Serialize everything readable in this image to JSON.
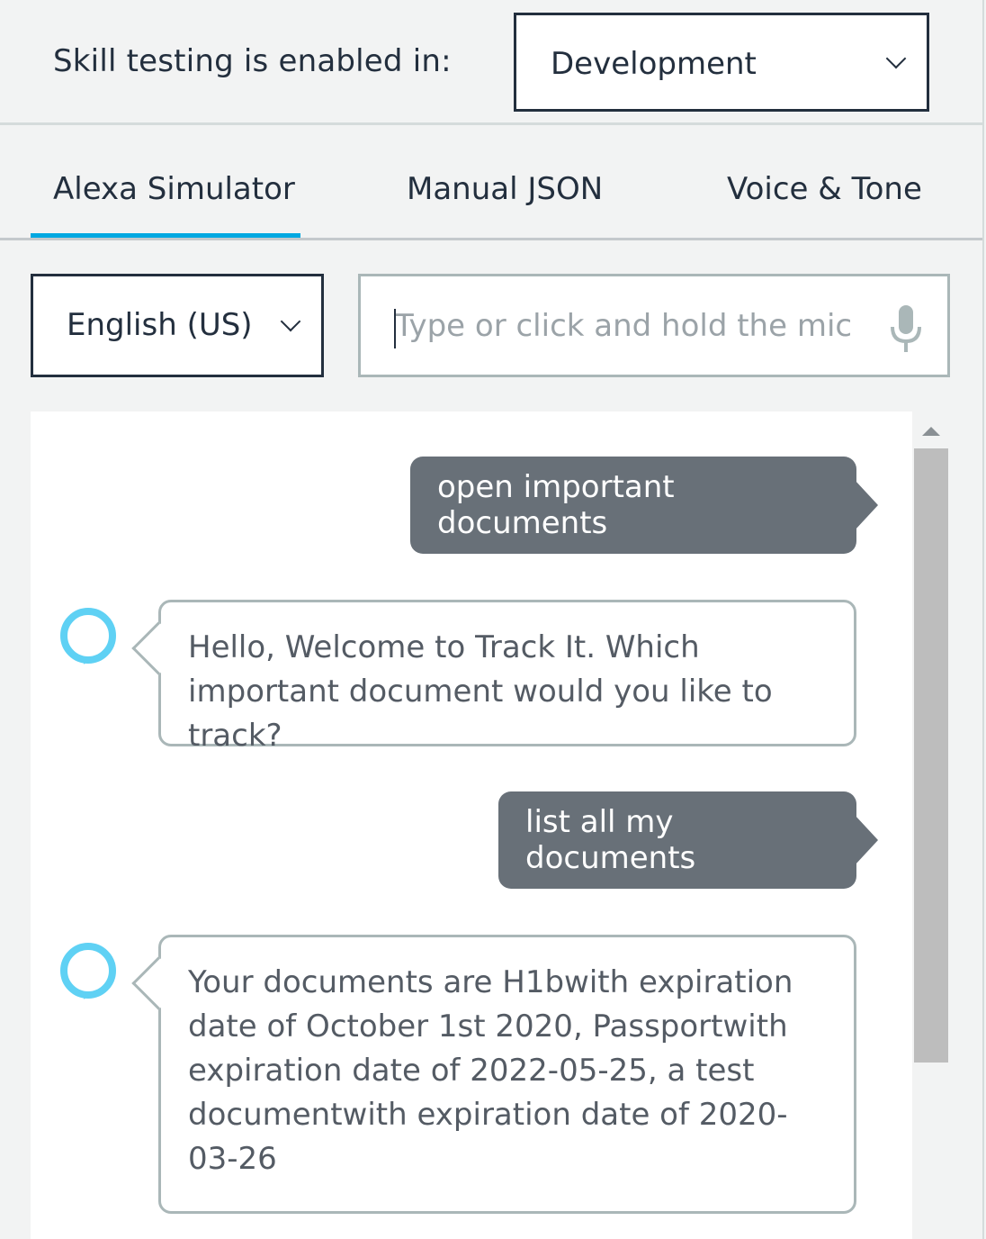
{
  "testing": {
    "label": "Skill testing is enabled in:",
    "stage_selected": "Development"
  },
  "tabs": [
    {
      "label": "Alexa Simulator",
      "active": true
    },
    {
      "label": "Manual JSON",
      "active": false
    },
    {
      "label": "Voice & Tone",
      "active": false
    }
  ],
  "locale": {
    "selected": "English (US)"
  },
  "utterance": {
    "placeholder": "Type or click and hold the mic",
    "value": ""
  },
  "conversation": [
    {
      "speaker": "user",
      "text": "open important documents"
    },
    {
      "speaker": "alexa",
      "text": "Hello, Welcome to Track It. Which important document would you like to track?"
    },
    {
      "speaker": "user",
      "text": "list all my documents"
    },
    {
      "speaker": "alexa",
      "text": "Your documents are H1bwith expiration date of October 1st 2020, Passportwith expiration date of 2022-05-25, a test documentwith expiration date of 2020-03-26"
    }
  ],
  "icons": {
    "stage_dropdown": "chevron-down-icon",
    "locale_dropdown": "chevron-down-icon",
    "mic": "microphone-icon",
    "alexa": "alexa-ring-icon",
    "scroll_up": "scroll-up-arrow-icon"
  },
  "colors": {
    "accent": "#00a8e1",
    "user_bubble": "#687078",
    "alexa_ring": "#5fd1f4"
  }
}
